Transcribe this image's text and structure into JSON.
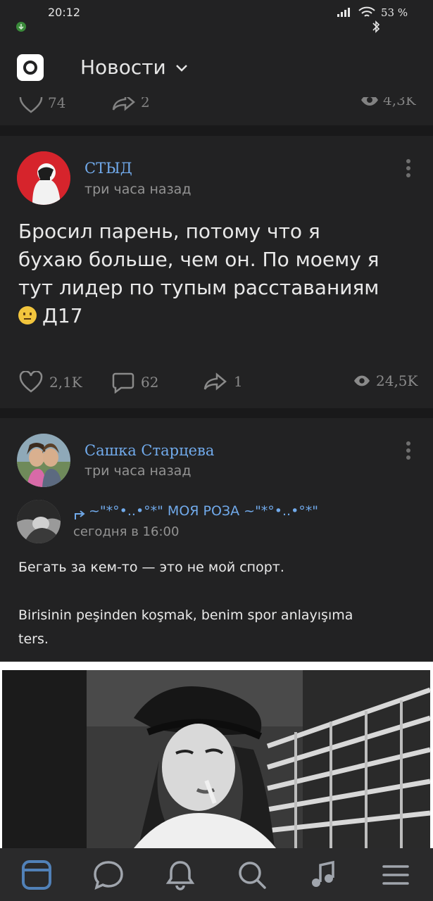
{
  "status": {
    "time": "20:12",
    "battery": "53 %"
  },
  "header": {
    "title": "Новости"
  },
  "prev_post": {
    "likes": "74",
    "reposts": "2",
    "views": "4,3K"
  },
  "post1": {
    "author": "СТЫД",
    "time": "три часа назад",
    "text_line1": "Бросил парень, потому что я",
    "text_line2": "бухаю больше, чем он. По моему я",
    "text_line3": "тут лидер по тупым расставаниям",
    "text_line4": "Д17",
    "likes": "2,1K",
    "comments": "62",
    "reposts": "1",
    "views": "24,5K"
  },
  "post2": {
    "author": "Сашка Старцева",
    "time": "три часа назад",
    "repost": {
      "author": "~\"*°•..•°*\" МОЯ РОЗА ~\"*°•..•°*\"",
      "time": "сегодня в 16:00",
      "text_ru": "Бегать за кем-то — это не мой спорт.",
      "text_tr_line1": "Birisinin peşinden koşmak, benim spor anlayışıma",
      "text_tr_line2": "ters."
    }
  },
  "tabs": [
    {
      "icon": "news-tab-icon",
      "active": true
    },
    {
      "icon": "messages-tab-icon",
      "active": false
    },
    {
      "icon": "notifications-tab-icon",
      "active": false
    },
    {
      "icon": "search-tab-icon",
      "active": false
    },
    {
      "icon": "music-tab-icon",
      "active": false
    },
    {
      "icon": "menu-tab-icon",
      "active": false
    }
  ],
  "colors": {
    "background": "#19191a",
    "card": "#222223",
    "link": "#71aaeb",
    "accent": "#5181b8",
    "icon": "#a0a5ad"
  }
}
